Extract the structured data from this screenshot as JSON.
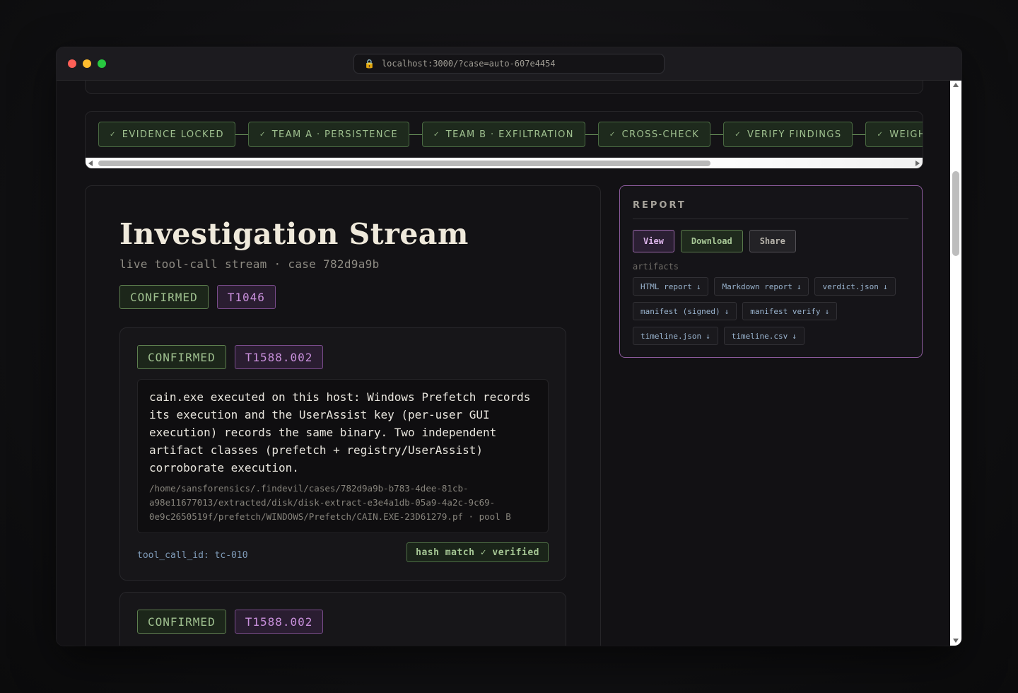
{
  "browser": {
    "url": "localhost:3000/?case=auto-607e4454"
  },
  "pipeline": {
    "steps": [
      {
        "label": "EVIDENCE LOCKED"
      },
      {
        "label": "TEAM A · PERSISTENCE"
      },
      {
        "label": "TEAM B · EXFILTRATION"
      },
      {
        "label": "CROSS-CHECK"
      },
      {
        "label": "VERIFY FINDINGS"
      },
      {
        "label": "WEIGH"
      }
    ],
    "check_glyph": "✓"
  },
  "stream": {
    "title": "Investigation Stream",
    "subtitle": "live tool-call stream · case 782d9a9b",
    "status_tag": "CONFIRMED",
    "technique_tag": "T1046",
    "findings": [
      {
        "status": "CONFIRMED",
        "technique": "T1588.002",
        "claim": "cain.exe executed on this host: Windows Prefetch records its execution and the UserAssist key (per-user GUI execution) records the same binary. Two independent artifact classes (prefetch + registry/UserAssist) corroborate execution.",
        "path": "/home/sansforensics/.findevil/cases/782d9a9b-b783-4dee-81cb-a98e11677013/extracted/disk/disk-extract-e3e4a1db-05a9-4a2c-9c69-0e9c2650519f/prefetch/WINDOWS/Prefetch/CAIN.EXE-23D61279.pf",
        "pool": " · pool B",
        "tool_call_id": "tool_call_id: tc-010",
        "hash_badge": "hash match ✓ verified"
      },
      {
        "status": "CONFIRMED",
        "technique": "T1588.002"
      }
    ]
  },
  "report": {
    "heading": "REPORT",
    "buttons": {
      "view": "View",
      "download": "Download",
      "share": "Share"
    },
    "artifacts_label": "artifacts",
    "download_glyph": "↓",
    "artifacts": [
      {
        "label": "HTML report"
      },
      {
        "label": "Markdown report"
      },
      {
        "label": "verdict.json"
      },
      {
        "label": "manifest (signed)"
      },
      {
        "label": "manifest verify"
      },
      {
        "label": "timeline.json"
      },
      {
        "label": "timeline.csv"
      }
    ]
  },
  "colors": {
    "confirmed_green": "#9fc08f",
    "technique_purple": "#c990dc",
    "report_border": "#8b5a9b",
    "link_blue": "#9ab4cf"
  },
  "icons": {
    "lock": "lock-icon",
    "check": "check-icon",
    "download": "download-icon"
  }
}
